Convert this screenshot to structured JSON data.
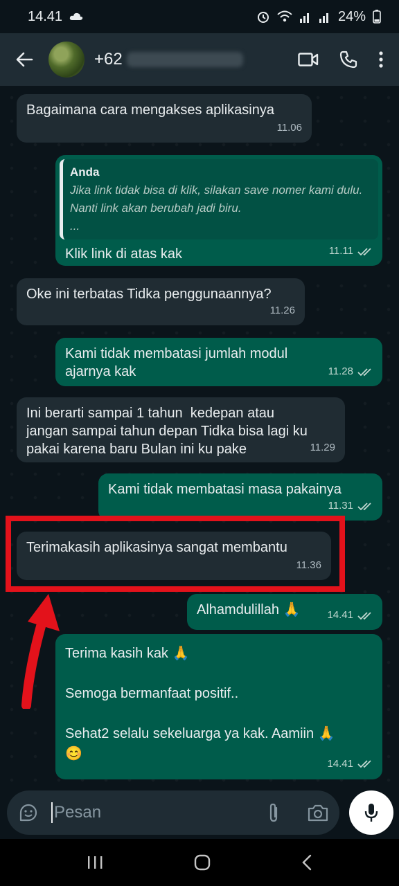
{
  "status_bar": {
    "time": "14.41",
    "battery": "24%"
  },
  "header": {
    "contact_prefix": "+62"
  },
  "messages": [
    {
      "text": "Bagaimana cara mengakses aplikasinya",
      "time": "11.06"
    },
    {
      "quote_author": "Anda",
      "quote_text": "Jika link tidak bisa di klik, silakan save nomer kami dulu. Nanti link akan berubah jadi biru.\n...",
      "text": "Klik link di atas kak",
      "time": "11.11"
    },
    {
      "text": "Oke ini terbatas Tidka penggunaannya?",
      "time": "11.26"
    },
    {
      "text": "Kami tidak membatasi jumlah modul ajarnya kak",
      "time": "11.28"
    },
    {
      "text": "Ini berarti sampai 1 tahun  kedepan atau jangan sampai tahun depan Tidka bisa lagi ku pakai karena baru Bulan ini ku pake",
      "time": "11.29"
    },
    {
      "text": "Kami tidak membatasi masa pakainya",
      "time": "11.31"
    },
    {
      "text": "Terimakasih aplikasinya sangat membantu",
      "time": "11.36"
    },
    {
      "text": "Alhamdulillah 🙏",
      "time": "14.41"
    },
    {
      "text": "Terima kasih kak 🙏\n\nSemoga bermanfaat positif..\n\nSehat2 selalu sekeluarga ya kak. Aamiin 🙏\n😊",
      "time": "14.41"
    }
  ],
  "input": {
    "placeholder": "Pesan"
  },
  "colors": {
    "background": "#0b141a",
    "incoming": "#202c33",
    "outgoing": "#005c4b",
    "highlight": "#e3121b",
    "ticks": "#53bdeb"
  }
}
